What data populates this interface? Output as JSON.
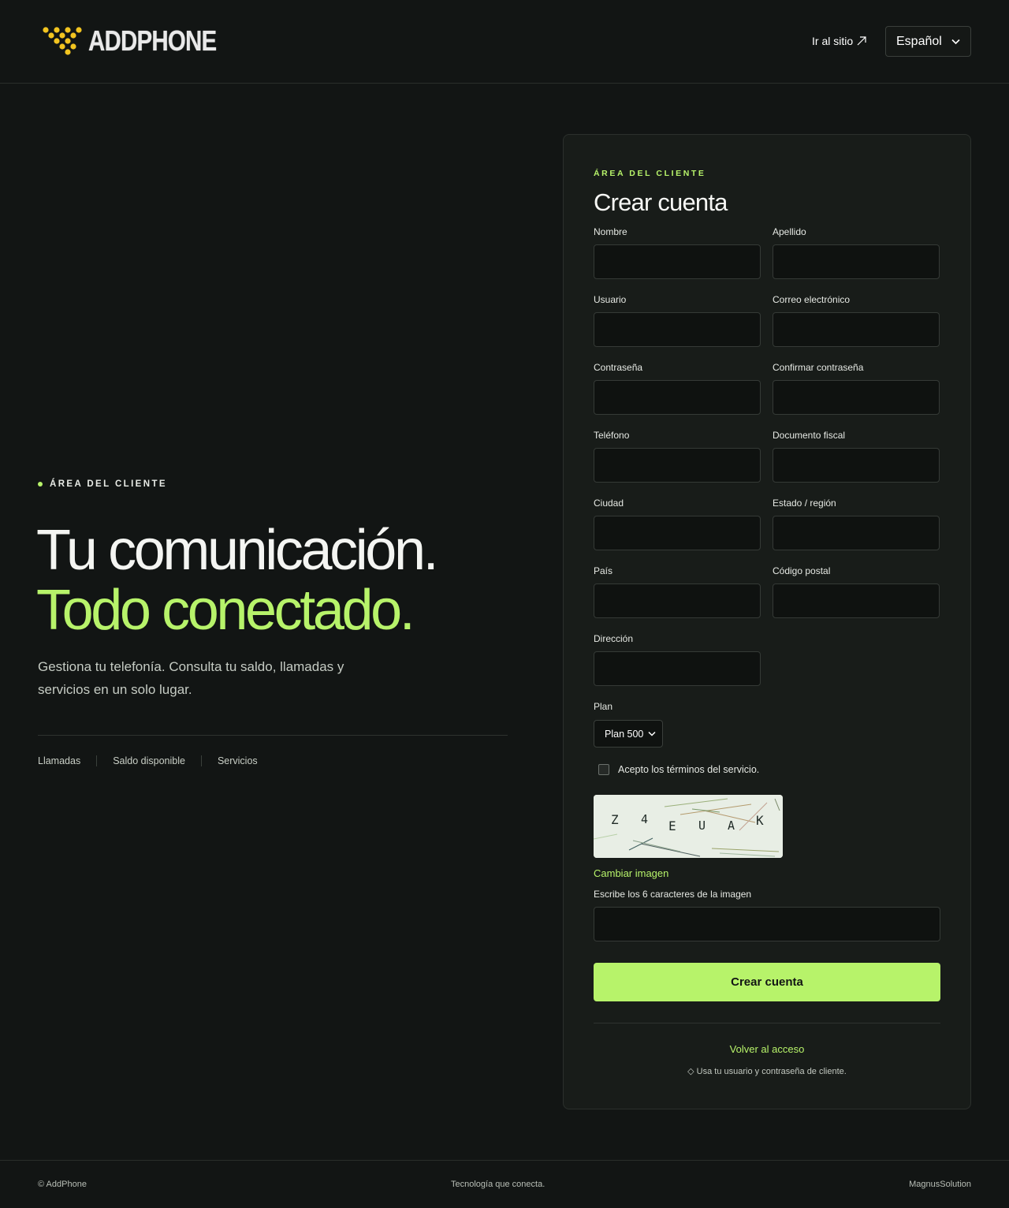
{
  "header": {
    "logo_text": "ADDPHONE",
    "goto_site": "Ir al sitio",
    "language": "Español"
  },
  "hero": {
    "eyebrow": "ÁREA DEL CLIENTE",
    "title_line1": "Tu comunicación.",
    "title_line2": "Todo conectado.",
    "subtitle": "Gestiona tu telefonía. Consulta tu saldo, llamadas y servicios en un solo lugar.",
    "links": [
      "Llamadas",
      "Saldo disponible",
      "Servicios"
    ]
  },
  "form": {
    "eyebrow": "ÁREA DEL CLIENTE",
    "title": "Crear cuenta",
    "fields": {
      "nombre": "Nombre",
      "apellido": "Apellido",
      "usuario": "Usuario",
      "correo": "Correo electrónico",
      "contrasena": "Contraseña",
      "confirmar": "Confirmar contraseña",
      "telefono": "Teléfono",
      "documento": "Documento fiscal",
      "ciudad": "Ciudad",
      "estado": "Estado / región",
      "pais": "País",
      "codigo_postal": "Código postal",
      "direccion": "Dirección"
    },
    "plan_label": "Plan",
    "plan_value": "Plan 500",
    "terms": "Acepto los términos del servicio.",
    "captcha_chars": [
      "Z",
      "4",
      "E",
      "U",
      "A",
      "K"
    ],
    "change_image": "Cambiar imagen",
    "captcha_label": "Escribe los 6 caracteres de la imagen",
    "submit": "Crear cuenta",
    "back": "Volver al acceso",
    "hint": "◇ Usa tu usuario y contraseña de cliente."
  },
  "footer": {
    "left": "© AddPhone",
    "center": "Tecnología que conecta.",
    "right": "MagnusSolution"
  },
  "colors": {
    "background": "#121514",
    "accent": "#b7f36a",
    "logo_dots": "#f2c420"
  }
}
